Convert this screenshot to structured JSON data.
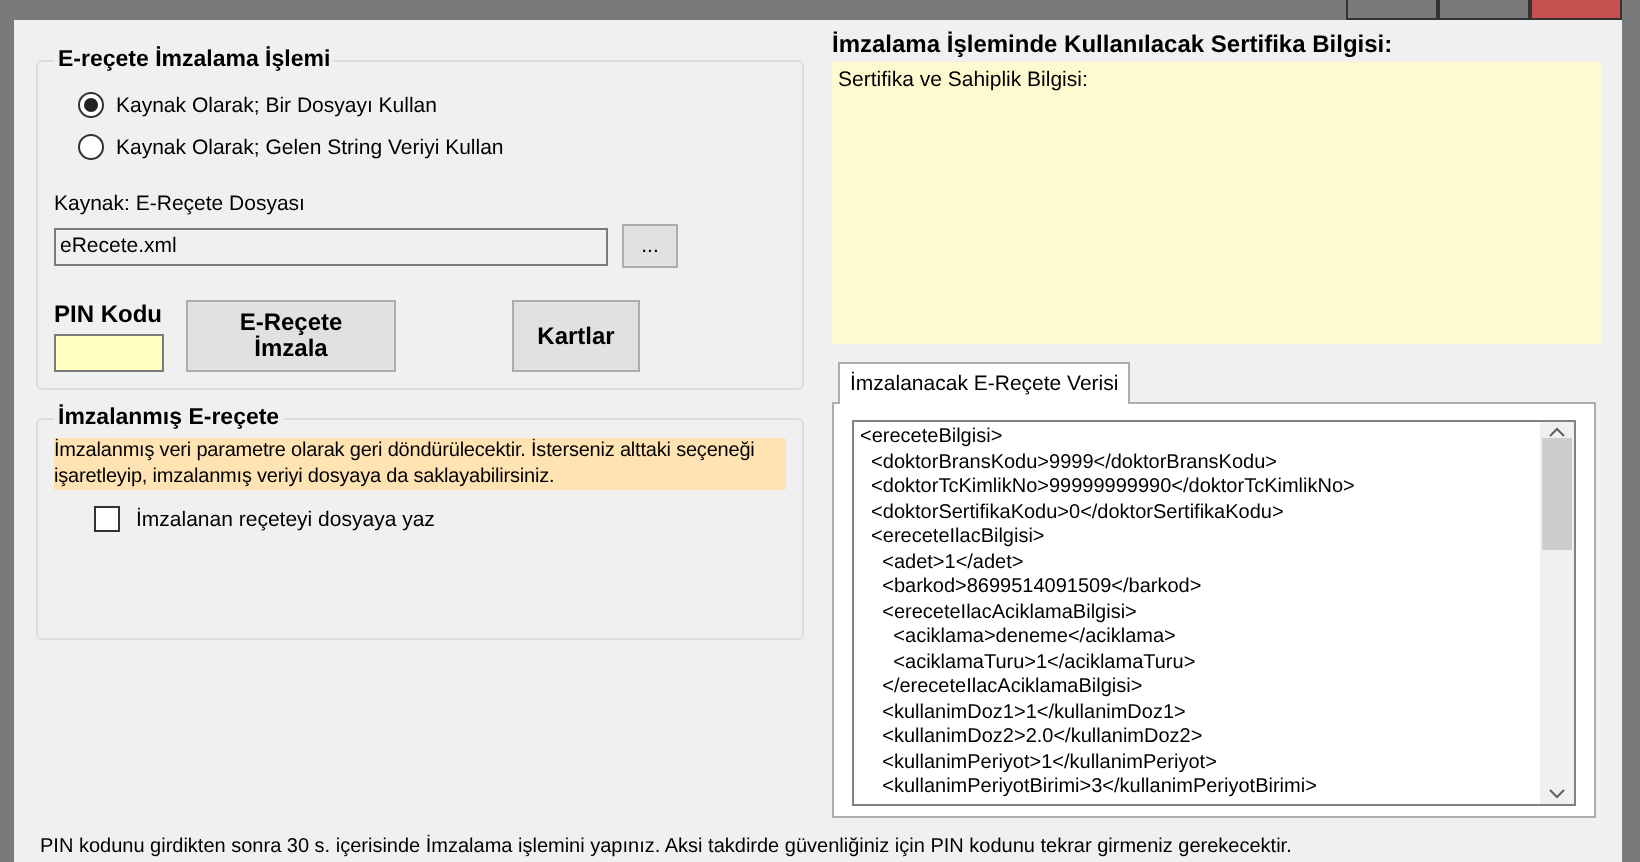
{
  "sign_group": {
    "title": "E-reçete İmzalama İşlemi",
    "sources": [
      {
        "label": "Kaynak Olarak; Bir Dosyayı Kullan",
        "selected": true
      },
      {
        "label": "Kaynak Olarak; Gelen String Veriyi Kullan",
        "selected": false
      }
    ],
    "file_label": "Kaynak: E-Reçete Dosyası",
    "file_value": "eRecete.xml",
    "browse_button": "...",
    "pin_label": "PIN Kodu",
    "sign_button": "E-Reçete\nİmzala",
    "cards_button": "Kartlar"
  },
  "signed_group": {
    "title": "İmzalanmış E-reçete",
    "note": "İmzalanmış veri parametre olarak geri döndürülecektir. İsterseniz alttaki seçeneği işaretleyip, imzalanmış veriyi dosyaya da saklayabilirsiniz.",
    "save_option": {
      "label": "İmzalanan reçeteyi dosyaya yaz",
      "checked": false
    }
  },
  "certificate": {
    "title": "İmzalama İşleminde Kullanılacak Sertifika Bilgisi:",
    "text": "Sertifika ve Sahiplik Bilgisi:"
  },
  "tabs": [
    {
      "label": "İmzalanacak E-Reçete Verisi",
      "selected": true
    }
  ],
  "xml_lines": [
    "<ereceteBilgisi>",
    "  <doktorBransKodu>9999</doktorBransKodu>",
    "  <doktorTcKimlikNo>99999999990</doktorTcKimlikNo>",
    "  <doktorSertifikaKodu>0</doktorSertifikaKodu>",
    "  <ereceteIlacBilgisi>",
    "    <adet>1</adet>",
    "    <barkod>8699514091509</barkod>",
    "    <ereceteIlacAciklamaBilgisi>",
    "      <aciklama>deneme</aciklama>",
    "      <aciklamaTuru>1</aciklamaTuru>",
    "    </ereceteIlacAciklamaBilgisi>",
    "    <kullanimDoz1>1</kullanimDoz1>",
    "    <kullanimDoz2>2.0</kullanimDoz2>",
    "    <kullanimPeriyot>1</kullanimPeriyot>",
    "    <kullanimPeriyotBirimi>3</kullanimPeriyotBirimi>"
  ],
  "status": "PIN kodunu girdikten sonra 30 s. içerisinde İmzalama işlemini yapınız. Aksi takdirde güvenliğiniz için PIN kodunu tekrar girmeniz gerekecektir."
}
